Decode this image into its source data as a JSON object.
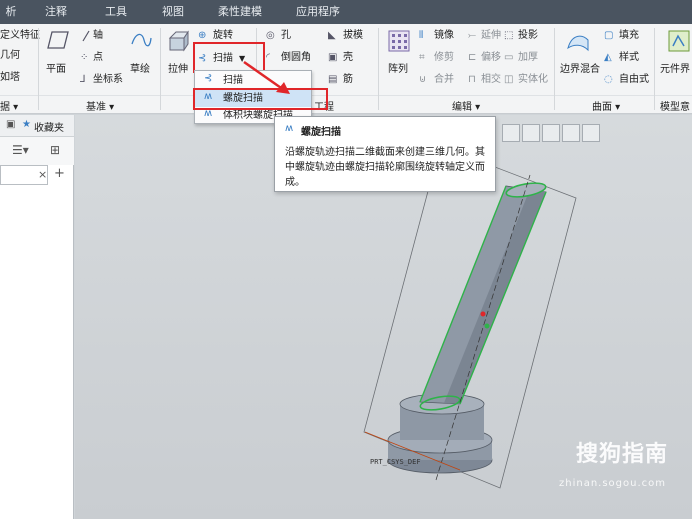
{
  "tabs": [
    "析",
    "注释",
    "工具",
    "视图",
    "柔性建模",
    "应用程序"
  ],
  "ribbon": {
    "partial_left": [
      "定义特征",
      "几何",
      "如塔"
    ],
    "datum": {
      "plane": "平面",
      "axis": "轴",
      "point": "点",
      "csys": "坐标系",
      "sketch": "草绘"
    },
    "shapes": {
      "extrude": "拉伸",
      "revolve": "旋转",
      "sweep": "扫描",
      "dropdown_arrow": "▼"
    },
    "engineering": {
      "hole": "孔",
      "round": "倒圆角",
      "draft": "拔模",
      "shell": "壳",
      "rib": "筋",
      "partial": "工程"
    },
    "editing": {
      "pattern": "阵列",
      "mirror": "镜像",
      "extend": "延伸",
      "project": "投影",
      "trim": "修剪",
      "offset": "偏移",
      "thicken": "加厚",
      "merge": "合并",
      "intersect": "相交",
      "solidify": "实体化"
    },
    "surfaces": {
      "boundary": "边界混合",
      "fill": "填充",
      "style": "样式",
      "freestyle": "自由式"
    },
    "model_intent": {
      "component_interface": "元件界"
    },
    "group_labels": {
      "left": "据 ▾",
      "datum": "基准 ▾",
      "editing": "编辑 ▾",
      "surfaces": "曲面 ▾",
      "model_intent": "模型意"
    }
  },
  "dropdown": {
    "items": [
      {
        "label": "扫描"
      },
      {
        "label": "螺旋扫描"
      },
      {
        "label": "体积块螺旋扫描"
      }
    ]
  },
  "tooltip": {
    "title": "螺旋扫描",
    "body": "沿螺旋轨迹扫描二维截面来创建三维几何。其中螺旋轨迹由螺旋扫描轮廓围绕旋转轴定义而成。"
  },
  "left_panel": {
    "tab": "收藏夹"
  },
  "graphics": {
    "csys_label": "PRT_CSYS_DEF"
  },
  "watermark": {
    "text": "搜狗指南",
    "url": "zhinan.sogou.com"
  },
  "colors": {
    "highlight_red": "#e0262a",
    "tab_bar": "#4a5460",
    "model_gray": "#8f99a6",
    "selection_green": "#2fb34a"
  }
}
